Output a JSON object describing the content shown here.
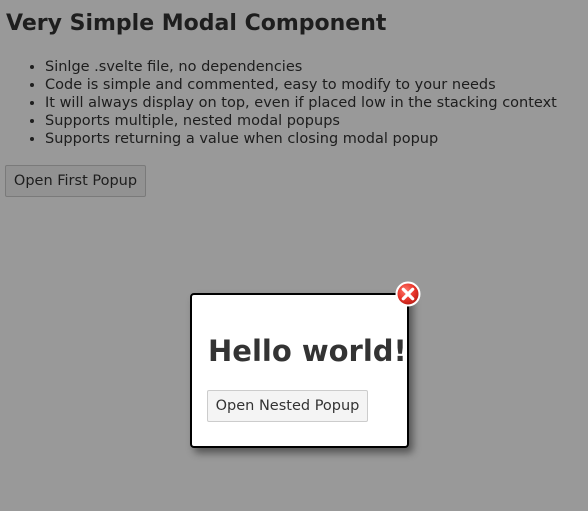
{
  "page": {
    "title": "Very Simple Modal Component",
    "features": [
      "Sinlge .svelte file, no dependencies",
      "Code is simple and commented, easy to modify to your needs",
      "It will always display on top, even if placed low in the stacking context",
      "Supports multiple, nested modal popups",
      "Supports returning a value when closing modal popup"
    ],
    "open_first_label": "Open First Popup"
  },
  "modal": {
    "heading": "Hello world!",
    "open_nested_label": "Open Nested Popup",
    "close_icon": "close-icon"
  },
  "colors": {
    "overlay": "rgba(0,0,0,0.4)",
    "close_red": "#e8352b",
    "modal_border": "#000000"
  }
}
